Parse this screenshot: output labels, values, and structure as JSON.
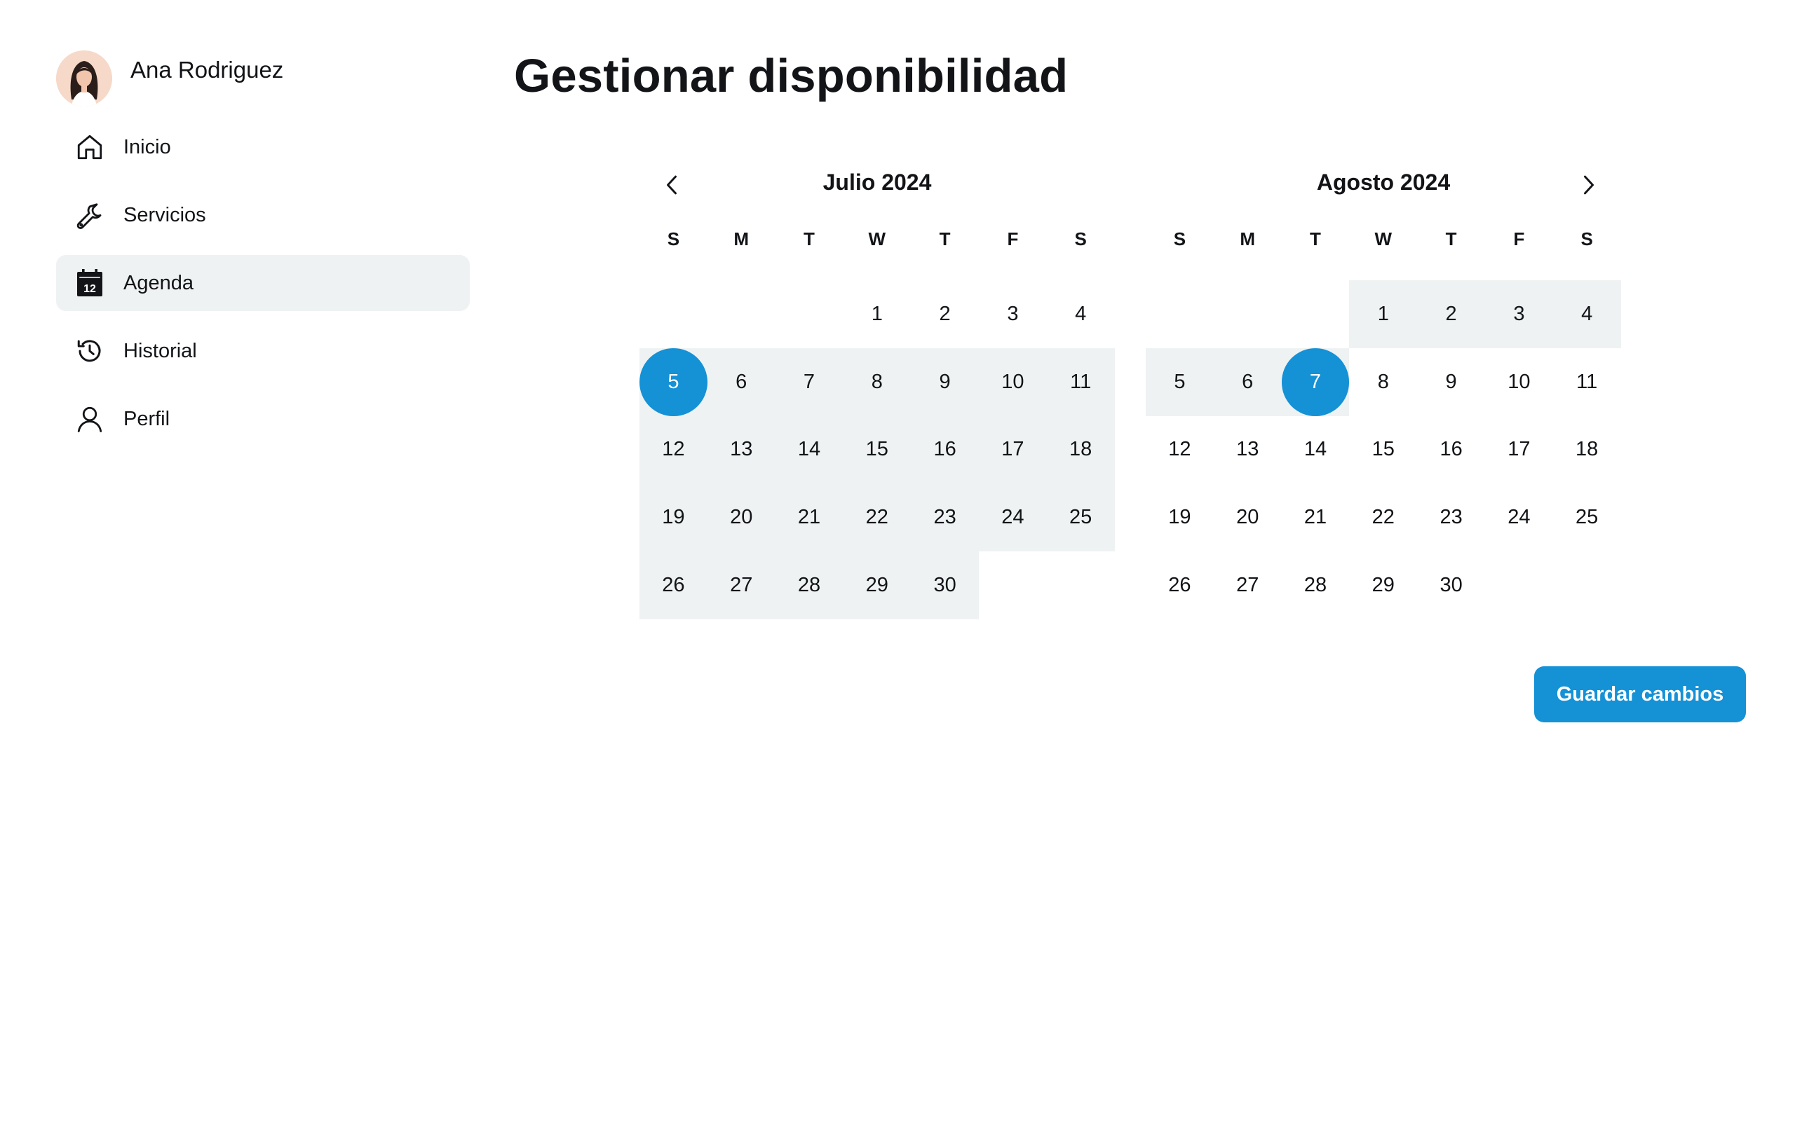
{
  "user": {
    "name": "Ana Rodriguez"
  },
  "nav": {
    "items": [
      {
        "label": "Inicio",
        "icon": "home-icon",
        "active": false
      },
      {
        "label": "Servicios",
        "icon": "wrench-icon",
        "active": false
      },
      {
        "label": "Agenda",
        "icon": "calendar-icon",
        "active": true
      },
      {
        "label": "Historial",
        "icon": "history-icon",
        "active": false
      },
      {
        "label": "Perfil",
        "icon": "user-icon",
        "active": false
      }
    ],
    "calendar_icon_day": "12"
  },
  "page": {
    "title": "Gestionar disponibilidad"
  },
  "calendars": [
    {
      "title": "Julio 2024",
      "weekdays": [
        "S",
        "M",
        "T",
        "W",
        "T",
        "F",
        "S"
      ],
      "leading_blanks": 3,
      "days": 30,
      "range_start": 5,
      "range_end": 30,
      "selected": 5
    },
    {
      "title": "Agosto 2024",
      "weekdays": [
        "S",
        "M",
        "T",
        "W",
        "T",
        "F",
        "S"
      ],
      "leading_blanks": 3,
      "days": 30,
      "range_start": 1,
      "range_end": 7,
      "selected": 7
    }
  ],
  "actions": {
    "save_label": "Guardar cambios"
  },
  "colors": {
    "accent": "#1591d6",
    "range_bg": "#eff2f2",
    "text": "#121417"
  }
}
